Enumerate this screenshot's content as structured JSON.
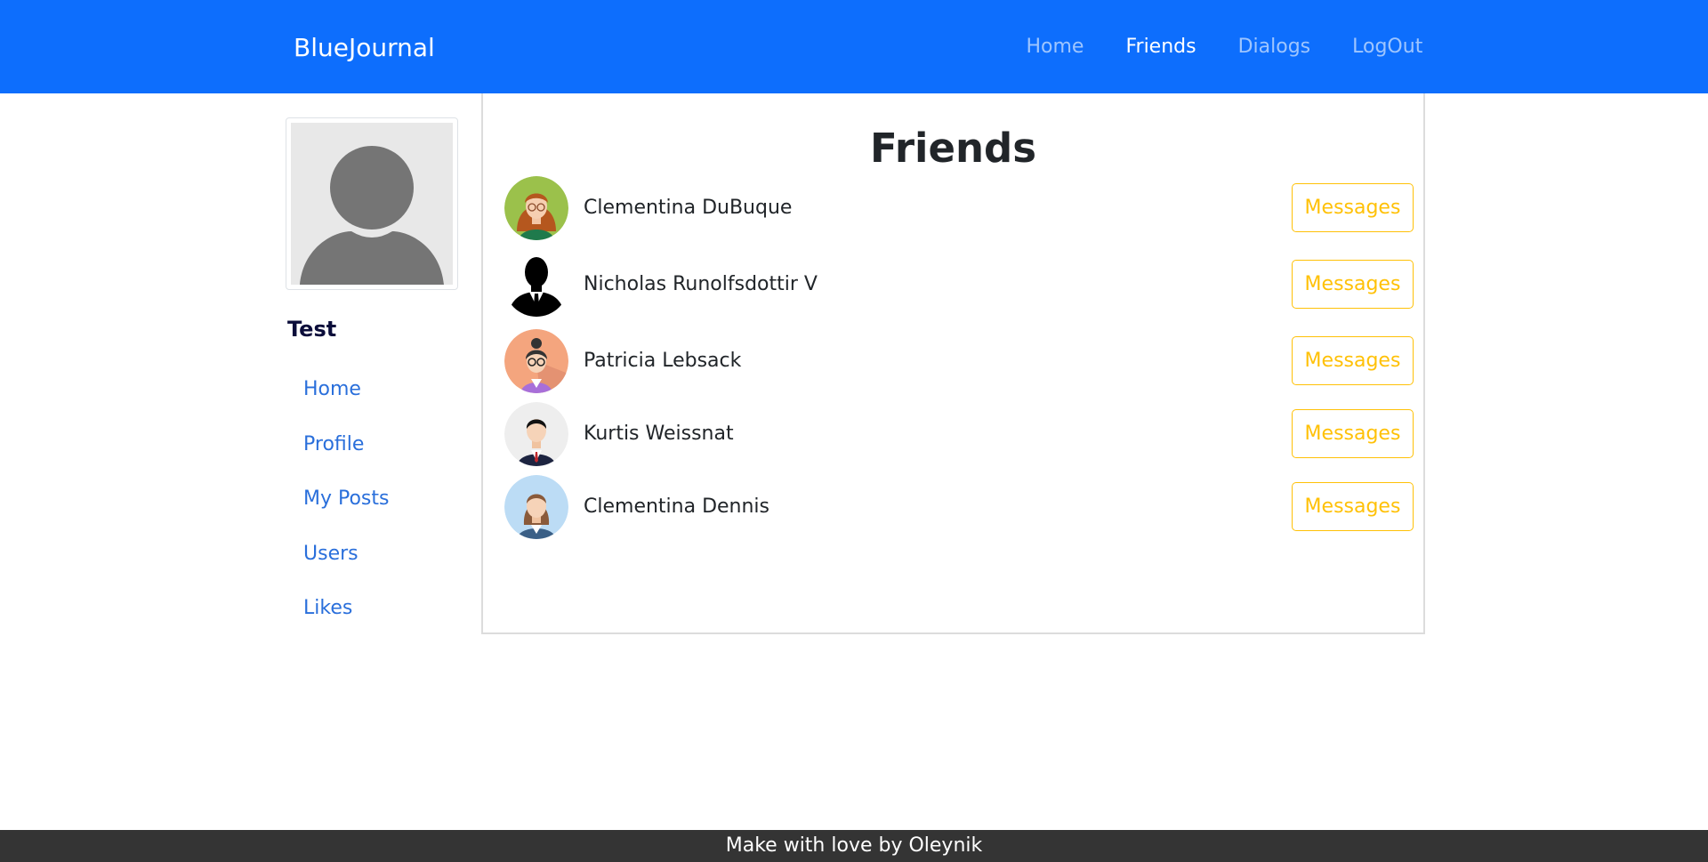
{
  "navbar": {
    "brand": "BlueJournal",
    "links": [
      {
        "label": "Home",
        "active": false
      },
      {
        "label": "Friends",
        "active": true
      },
      {
        "label": "Dialogs",
        "active": false
      },
      {
        "label": "LogOut",
        "active": false
      }
    ]
  },
  "sidebar": {
    "avatar_icon": "default-user-avatar-icon",
    "username": "Test",
    "items": [
      {
        "label": "Home"
      },
      {
        "label": "Profile"
      },
      {
        "label": "My Posts"
      },
      {
        "label": "Users"
      },
      {
        "label": "Likes"
      }
    ]
  },
  "main": {
    "title": "Friends",
    "friends": [
      {
        "name": "Clementina DuBuque",
        "button": "Messages",
        "avatar_icon": "woman-glasses-avatar-icon"
      },
      {
        "name": "Nicholas Runolfsdottir V",
        "button": "Messages",
        "avatar_icon": "man-silhouette-avatar-icon"
      },
      {
        "name": "Patricia Lebsack",
        "button": "Messages",
        "avatar_icon": "woman-bun-glasses-avatar-icon"
      },
      {
        "name": "Kurtis Weissnat",
        "button": "Messages",
        "avatar_icon": "businessman-avatar-icon"
      },
      {
        "name": "Clementina Dennis",
        "button": "Messages",
        "avatar_icon": "businesswoman-avatar-icon"
      }
    ]
  },
  "footer": {
    "text": "Make with love by Oleynik"
  },
  "colors": {
    "navbar": "#0d6efd",
    "link": "#2a6fdb",
    "button_outline": "#ffc107",
    "footer": "#343434"
  }
}
